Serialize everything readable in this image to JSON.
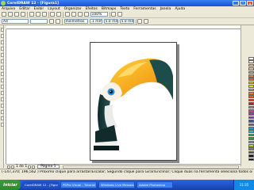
{
  "window": {
    "title": "CorelDRAW 12 - [Figura1]",
    "controls": [
      "_",
      "□",
      "x"
    ]
  },
  "menu": [
    "Arquivo",
    "Editar",
    "Exibir",
    "Layout",
    "Organizar",
    "Efeitos",
    "Bitmaps",
    "Texto",
    "Ferramentas",
    "Janela",
    "Ajuda"
  ],
  "toolbar": {
    "zoom": "100%",
    "paper_size": "A4",
    "units": "milímetros",
    "nudge": ".1 mm",
    "dup_x": "5.0 mm",
    "dup_y": "5.0 mm"
  },
  "document": {
    "page_tab": "Página 1",
    "page_counter": "1 de 1"
  },
  "status": {
    "line1": "(-147,370; 196,562 )   Próximo clique para arrastar/Escalar; Segundo clique para Girar/Enclinar; Clique duas na ferramenta seleciona todos os objetos; Shift+Clique",
    "line2": ""
  },
  "palette_colors": [
    "#ffffff",
    "#f5e9dc",
    "#eed2b8",
    "#e7b894",
    "#de9f72",
    "#d4874f",
    "#c46d2e",
    "#e8c35a",
    "#f0d030",
    "#f7a21b",
    "#ee7f22",
    "#e4572a",
    "#d33a2c",
    "#b22222",
    "#e66b8e",
    "#c94a8a",
    "#9b3f9a",
    "#6a3d9a",
    "#3d4f9f",
    "#2c6fbb",
    "#2a96d4",
    "#37b6c9",
    "#2fa37a",
    "#3a9a3a",
    "#7ab648",
    "#b8cf3a",
    "#808080",
    "#4d4d4d",
    "#1a1a1a",
    "#000000"
  ],
  "taskbar": {
    "start": "Iniciar",
    "tasks": [
      "CorelDRAW 12 - [Figura1]",
      "PSPro Visual - Tutorial",
      "Windows Live Messenger",
      "Adobe Photoshop"
    ],
    "clock": "11:35"
  },
  "colors": {
    "beak_orange": "#f4a31c",
    "beak_yellow": "#ffcc33",
    "body_dark": "#1c3a3a",
    "eye_blue": "#2b8fd6"
  }
}
